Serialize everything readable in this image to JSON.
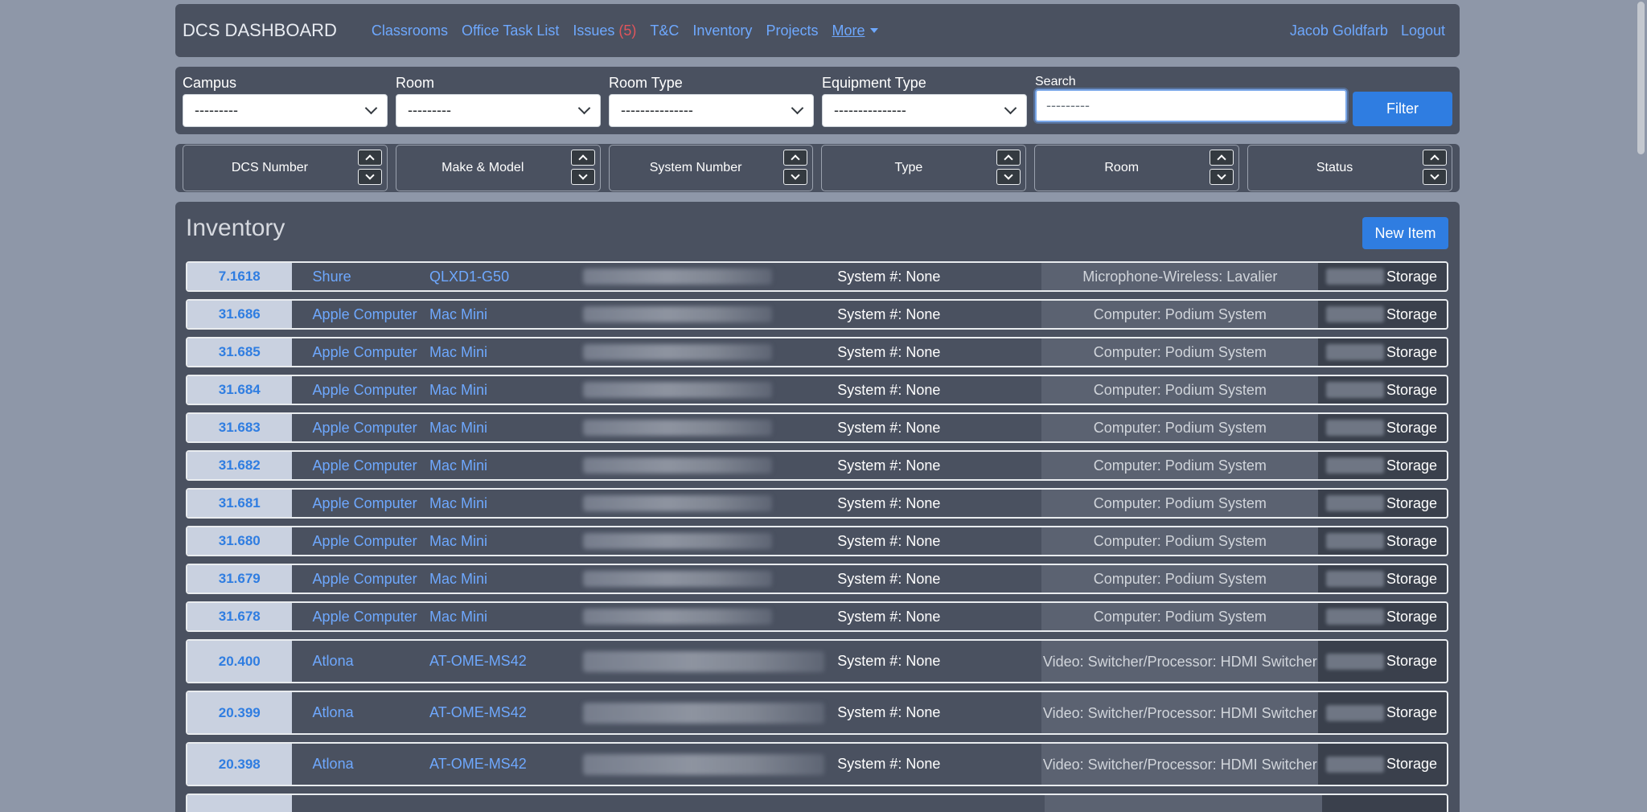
{
  "navbar": {
    "brand": "DCS DASHBOARD",
    "links": {
      "classrooms": "Classrooms",
      "office_task_list": "Office Task List",
      "issues": "Issues",
      "issues_count": "(5)",
      "tc": "T&C",
      "inventory": "Inventory",
      "projects": "Projects",
      "more": "More"
    },
    "user": "Jacob Goldfarb",
    "logout": "Logout"
  },
  "filters": {
    "campus": {
      "label": "Campus",
      "value": "---------"
    },
    "room": {
      "label": "Room",
      "value": "---------"
    },
    "room_type": {
      "label": "Room Type",
      "value": "---------------"
    },
    "equipment_type": {
      "label": "Equipment Type",
      "value": "---------------"
    },
    "search": {
      "label": "Search",
      "placeholder": "---------"
    },
    "filter_button": "Filter"
  },
  "sort": [
    "DCS Number",
    "Make & Model",
    "System Number",
    "Type",
    "Room",
    "Status"
  ],
  "inventory": {
    "title": "Inventory",
    "new_item": "New Item",
    "rows": [
      {
        "num": "7.1618",
        "make": "Shure",
        "model": "QLXD1-G50",
        "system": "System #: None",
        "type": "Microphone-Wireless: Lavalier",
        "status": "Storage"
      },
      {
        "num": "31.686",
        "make": "Apple Computer",
        "model": "Mac Mini",
        "system": "System #: None",
        "type": "Computer: Podium System",
        "status": "Storage"
      },
      {
        "num": "31.685",
        "make": "Apple Computer",
        "model": "Mac Mini",
        "system": "System #: None",
        "type": "Computer: Podium System",
        "status": "Storage"
      },
      {
        "num": "31.684",
        "make": "Apple Computer",
        "model": "Mac Mini",
        "system": "System #: None",
        "type": "Computer: Podium System",
        "status": "Storage"
      },
      {
        "num": "31.683",
        "make": "Apple Computer",
        "model": "Mac Mini",
        "system": "System #: None",
        "type": "Computer: Podium System",
        "status": "Storage"
      },
      {
        "num": "31.682",
        "make": "Apple Computer",
        "model": "Mac Mini",
        "system": "System #: None",
        "type": "Computer: Podium System",
        "status": "Storage"
      },
      {
        "num": "31.681",
        "make": "Apple Computer",
        "model": "Mac Mini",
        "system": "System #: None",
        "type": "Computer: Podium System",
        "status": "Storage"
      },
      {
        "num": "31.680",
        "make": "Apple Computer",
        "model": "Mac Mini",
        "system": "System #: None",
        "type": "Computer: Podium System",
        "status": "Storage"
      },
      {
        "num": "31.679",
        "make": "Apple Computer",
        "model": "Mac Mini",
        "system": "System #: None",
        "type": "Computer: Podium System",
        "status": "Storage"
      },
      {
        "num": "31.678",
        "make": "Apple Computer",
        "model": "Mac Mini",
        "system": "System #: None",
        "type": "Computer: Podium System",
        "status": "Storage"
      },
      {
        "num": "20.400",
        "make": "Atlona",
        "model": "AT-OME-MS42",
        "system": "System #: None",
        "type": "Video: Switcher/Processor: HDMI Switcher",
        "status": "Storage"
      },
      {
        "num": "20.399",
        "make": "Atlona",
        "model": "AT-OME-MS42",
        "system": "System #: None",
        "type": "Video: Switcher/Processor: HDMI Switcher",
        "status": "Storage"
      },
      {
        "num": "20.398",
        "make": "Atlona",
        "model": "AT-OME-MS42",
        "system": "System #: None",
        "type": "Video: Switcher/Processor: HDMI Switcher",
        "status": "Storage"
      }
    ]
  }
}
